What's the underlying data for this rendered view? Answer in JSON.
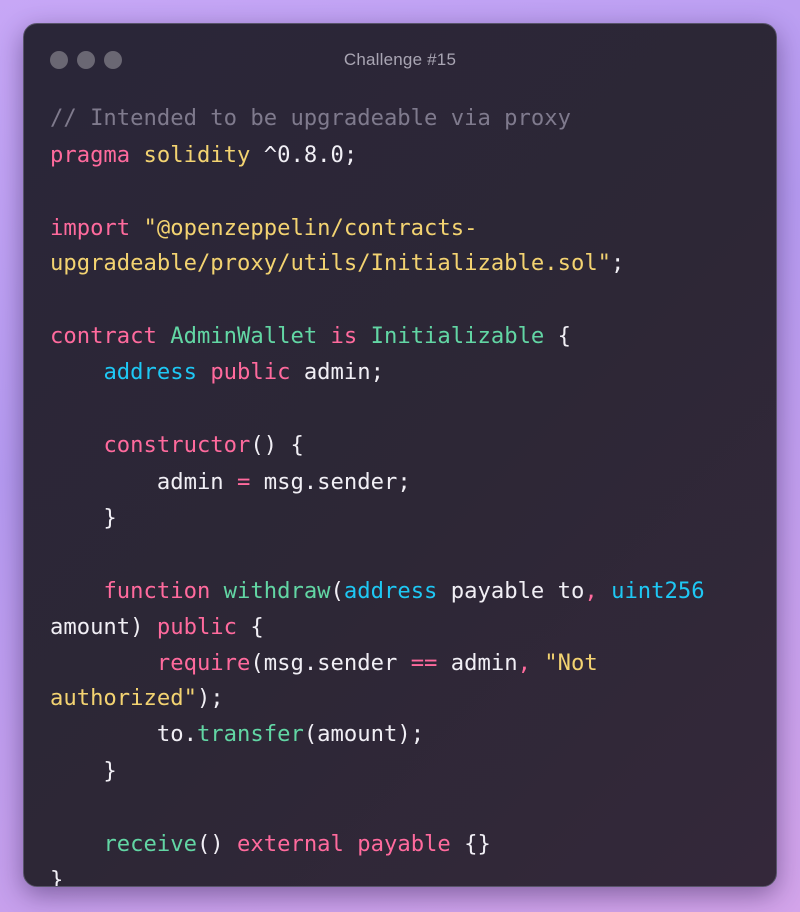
{
  "window": {
    "title": "Challenge #15",
    "controls": [
      "close-dot",
      "minimize-dot",
      "zoom-dot"
    ]
  },
  "colors": {
    "comment": "#7f7a8d",
    "keyword": "#ff6a9d",
    "string": "#f3d371",
    "type": "#62d6a4",
    "builtin": "#1ec8f4",
    "function": "#62d6a4",
    "plain": "#f1eff5"
  },
  "code_lines": [
    [
      {
        "t": "// Intended to be upgradeable via proxy",
        "c": "comment"
      }
    ],
    [
      {
        "t": "pragma",
        "c": "keyword"
      },
      {
        "t": " ",
        "c": "plain"
      },
      {
        "t": "solidity",
        "c": "string"
      },
      {
        "t": " ^0.8.0;",
        "c": "plain"
      }
    ],
    [],
    [
      {
        "t": "import",
        "c": "keyword"
      },
      {
        "t": " ",
        "c": "plain"
      },
      {
        "t": "\"@openzeppelin/contracts-",
        "c": "string"
      }
    ],
    [
      {
        "t": "upgradeable/proxy/utils/Initializable.sol\"",
        "c": "string"
      },
      {
        "t": ";",
        "c": "plain"
      }
    ],
    [],
    [
      {
        "t": "contract",
        "c": "keyword"
      },
      {
        "t": " ",
        "c": "plain"
      },
      {
        "t": "AdminWallet",
        "c": "type"
      },
      {
        "t": " ",
        "c": "plain"
      },
      {
        "t": "is",
        "c": "keyword"
      },
      {
        "t": " ",
        "c": "plain"
      },
      {
        "t": "Initializable",
        "c": "type"
      },
      {
        "t": " {",
        "c": "plain"
      }
    ],
    [
      {
        "t": "    ",
        "c": "plain"
      },
      {
        "t": "address",
        "c": "builtin"
      },
      {
        "t": " ",
        "c": "plain"
      },
      {
        "t": "public",
        "c": "keyword"
      },
      {
        "t": " admin;",
        "c": "plain"
      }
    ],
    [],
    [
      {
        "t": "    ",
        "c": "plain"
      },
      {
        "t": "constructor",
        "c": "keyword"
      },
      {
        "t": "() {",
        "c": "plain"
      }
    ],
    [
      {
        "t": "        admin ",
        "c": "plain"
      },
      {
        "t": "=",
        "c": "op"
      },
      {
        "t": " msg.sender;",
        "c": "plain"
      }
    ],
    [
      {
        "t": "    }",
        "c": "plain"
      }
    ],
    [],
    [
      {
        "t": "    ",
        "c": "plain"
      },
      {
        "t": "function",
        "c": "keyword"
      },
      {
        "t": " ",
        "c": "plain"
      },
      {
        "t": "withdraw",
        "c": "func"
      },
      {
        "t": "(",
        "c": "plain"
      },
      {
        "t": "address",
        "c": "builtin"
      },
      {
        "t": " payable to",
        "c": "plain"
      },
      {
        "t": ",",
        "c": "op"
      },
      {
        "t": " ",
        "c": "plain"
      },
      {
        "t": "uint256",
        "c": "builtin"
      }
    ],
    [
      {
        "t": "amount) ",
        "c": "plain"
      },
      {
        "t": "public",
        "c": "keyword"
      },
      {
        "t": " {",
        "c": "plain"
      }
    ],
    [
      {
        "t": "        ",
        "c": "plain"
      },
      {
        "t": "require",
        "c": "keyword"
      },
      {
        "t": "(msg.sender ",
        "c": "plain"
      },
      {
        "t": "==",
        "c": "op"
      },
      {
        "t": " admin",
        "c": "plain"
      },
      {
        "t": ",",
        "c": "op"
      },
      {
        "t": " ",
        "c": "plain"
      },
      {
        "t": "\"Not",
        "c": "string"
      }
    ],
    [
      {
        "t": "authorized\"",
        "c": "string"
      },
      {
        "t": ");",
        "c": "plain"
      }
    ],
    [
      {
        "t": "        to.",
        "c": "plain"
      },
      {
        "t": "transfer",
        "c": "func"
      },
      {
        "t": "(amount);",
        "c": "plain"
      }
    ],
    [
      {
        "t": "    }",
        "c": "plain"
      }
    ],
    [],
    [
      {
        "t": "    ",
        "c": "plain"
      },
      {
        "t": "receive",
        "c": "func"
      },
      {
        "t": "() ",
        "c": "plain"
      },
      {
        "t": "external",
        "c": "keyword"
      },
      {
        "t": " ",
        "c": "plain"
      },
      {
        "t": "payable",
        "c": "keyword"
      },
      {
        "t": " {}",
        "c": "plain"
      }
    ],
    [
      {
        "t": "}",
        "c": "plain"
      }
    ]
  ]
}
